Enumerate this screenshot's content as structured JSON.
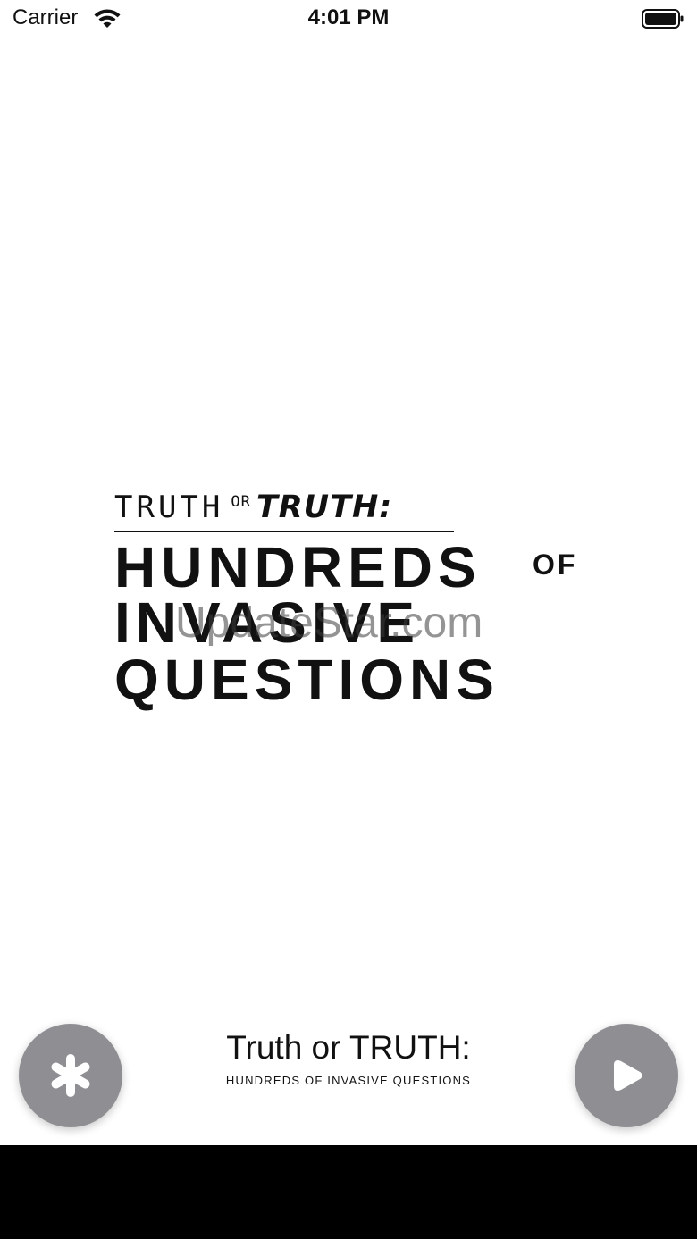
{
  "status_bar": {
    "carrier": "Carrier",
    "time": "4:01 PM",
    "icons": [
      "wifi-icon",
      "battery-icon"
    ]
  },
  "logo": {
    "line1_truth": "TRUTH",
    "line1_or": "OR",
    "line1_truth_caps": "TRUTH:",
    "line2": "HUNDREDS",
    "of": "OF",
    "line3": "INVASIVE",
    "line4": "QUESTIONS"
  },
  "watermark": "UpdateStar.com",
  "bottom_bar": {
    "title": "Truth or TRUTH:",
    "subtitle": "HUNDREDS OF INVASIVE QUESTIONS",
    "left_button_icon": "asterisk-icon",
    "right_button_icon": "play-icon"
  },
  "colors": {
    "button_gray": "#8e8e93",
    "text": "#111111",
    "bottom_bar": "#000000",
    "background": "#ffffff"
  }
}
